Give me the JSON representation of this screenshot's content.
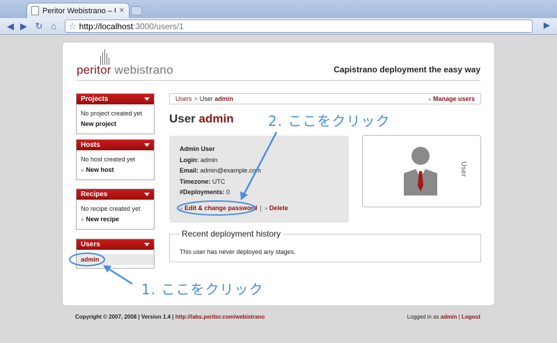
{
  "browser": {
    "tab_title": "Peritor Webistrano – User ad",
    "url_host": "http://localhost",
    "url_rest": ":3000/users/1"
  },
  "header": {
    "logo_part1": "peritor",
    "logo_part2": "webistrano",
    "tagline": "Capistrano deployment the easy way"
  },
  "sidebar": {
    "projects": {
      "title": "Projects",
      "empty_text": "No project created yet",
      "new_link": "New project"
    },
    "hosts": {
      "title": "Hosts",
      "empty_text": "No host created yet",
      "new_link": "New host"
    },
    "recipes": {
      "title": "Recipes",
      "empty_text": "No recipe created yet",
      "new_link": "New recipe"
    },
    "users": {
      "title": "Users",
      "items": [
        "admin"
      ]
    }
  },
  "breadcrumb": {
    "root": "Users",
    "separator": ">",
    "current_prefix": "User",
    "current_name": "admin",
    "manage_link": "Manage users"
  },
  "main": {
    "title_prefix": "User",
    "title_name": "admin",
    "info": {
      "name": "Admin User",
      "login_label": "Login:",
      "login_value": "admin",
      "email_label": "Email:",
      "email_value": "admin@example.com",
      "timezone_label": "Timezone:",
      "timezone_value": "UTC",
      "deployments_label": "#Deployments:",
      "deployments_value": "0"
    },
    "edit_link": "Edit & change password",
    "delete_link": "Delete",
    "user_card_label": "User",
    "history_title": "Recent deployment history",
    "history_empty": "This user has never deployed any stages."
  },
  "footer": {
    "copyright": "Copyright © 2007, 2008 | Version 1.4 |",
    "link": "http://labs.peritor.com/webistrano",
    "logged_in_prefix": "Logged in as",
    "user": "admin",
    "separator": "|",
    "logout": "Logout"
  },
  "annotations": {
    "step1": "1. ここをクリック",
    "step2": "2. ここをクリック",
    "color": "#4a8fe0"
  }
}
